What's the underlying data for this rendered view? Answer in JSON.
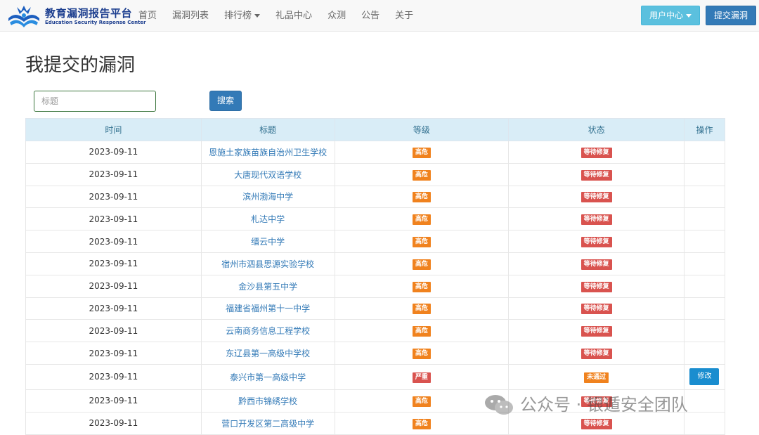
{
  "brand": {
    "title": "教育漏洞报告平台",
    "subtitle": "Education Security Response Center"
  },
  "nav": [
    {
      "label": "首页"
    },
    {
      "label": "漏洞列表"
    },
    {
      "label": "排行榜",
      "dropdown": true
    },
    {
      "label": "礼品中心"
    },
    {
      "label": "众测"
    },
    {
      "label": "公告"
    },
    {
      "label": "关于"
    }
  ],
  "header_buttons": {
    "user_center": "用户中心",
    "submit_vuln": "提交漏洞"
  },
  "page": {
    "title": "我提交的漏洞"
  },
  "search": {
    "placeholder": "标题",
    "button": "搜索"
  },
  "table": {
    "columns": [
      "时间",
      "标题",
      "等级",
      "状态",
      "操作"
    ],
    "rows": [
      {
        "time": "2023-09-11",
        "title": "恩施土家族苗族自治州卫生学校",
        "level": "高危",
        "status": "等待修复",
        "action": ""
      },
      {
        "time": "2023-09-11",
        "title": "大唐现代双语学校",
        "level": "高危",
        "status": "等待修复",
        "action": ""
      },
      {
        "time": "2023-09-11",
        "title": "滨州渤海中学",
        "level": "高危",
        "status": "等待修复",
        "action": ""
      },
      {
        "time": "2023-09-11",
        "title": "札达中学",
        "level": "高危",
        "status": "等待修复",
        "action": ""
      },
      {
        "time": "2023-09-11",
        "title": "缙云中学",
        "level": "高危",
        "status": "等待修复",
        "action": ""
      },
      {
        "time": "2023-09-11",
        "title": "宿州市泗县思源实验学校",
        "level": "高危",
        "status": "等待修复",
        "action": ""
      },
      {
        "time": "2023-09-11",
        "title": "金沙县第五中学",
        "level": "高危",
        "status": "等待修复",
        "action": ""
      },
      {
        "time": "2023-09-11",
        "title": "福建省福州第十一中学",
        "level": "高危",
        "status": "等待修复",
        "action": ""
      },
      {
        "time": "2023-09-11",
        "title": "云南商务信息工程学校",
        "level": "高危",
        "status": "等待修复",
        "action": ""
      },
      {
        "time": "2023-09-11",
        "title": "东辽县第一高级中学校",
        "level": "高危",
        "status": "等待修复",
        "action": ""
      },
      {
        "time": "2023-09-11",
        "title": "泰兴市第一高级中学",
        "level": "严重",
        "status": "未通过",
        "action": "修改"
      },
      {
        "time": "2023-09-11",
        "title": "黔西市锦绣学校",
        "level": "高危",
        "status": "等待修复",
        "action": ""
      },
      {
        "time": "2023-09-11",
        "title": "营口开发区第二高级中学",
        "level": "高危",
        "status": "等待修复",
        "action": ""
      }
    ]
  },
  "watermark": {
    "text": "公众号 · 银遁安全团队"
  },
  "colors": {
    "primary": "#337ab7",
    "info": "#5bc0de",
    "high": "#f0821e",
    "danger": "#d9534f",
    "header_bg": "#d9edf7"
  }
}
